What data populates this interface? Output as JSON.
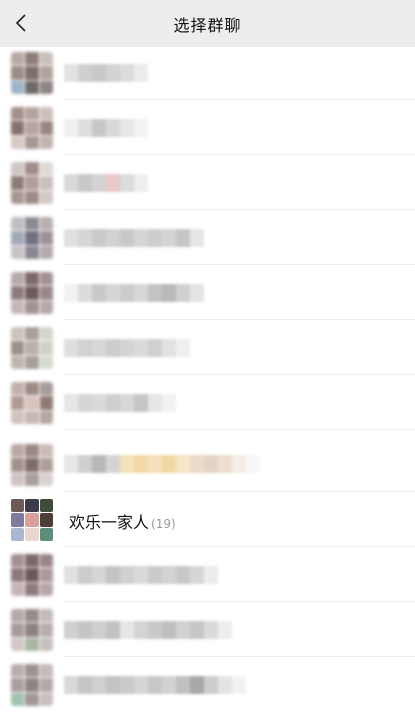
{
  "header": {
    "title": "选择群聊",
    "back_icon": "chevron-left-icon"
  },
  "group_list": {
    "highlighted": {
      "name": "欢乐一家人",
      "member_count": "(19)"
    }
  }
}
